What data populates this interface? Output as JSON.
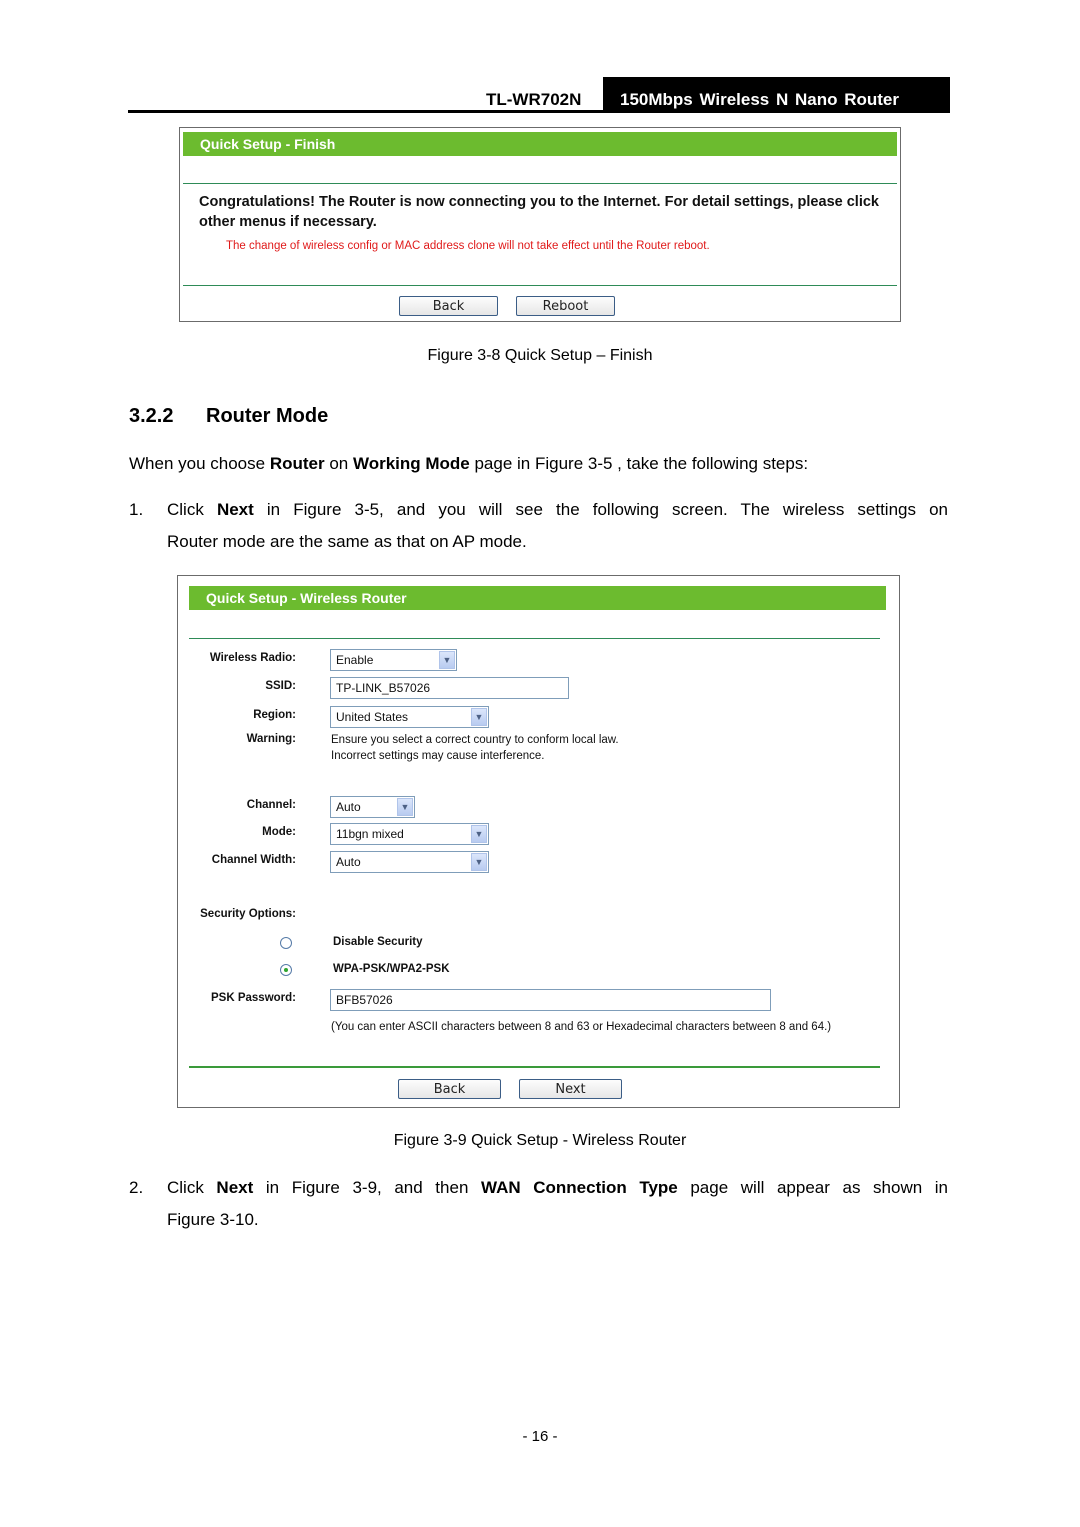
{
  "header": {
    "model": "TL-WR702N",
    "product": "150Mbps Wireless N Nano Router"
  },
  "figure_finish": {
    "title": "Quick Setup - Finish",
    "message": "Congratulations! The Router is now connecting you to the Internet. For detail settings, please click other menus if necessary.",
    "warning": "The change of wireless config or MAC address clone will not take effect until the Router reboot.",
    "buttons": {
      "back": "Back",
      "reboot": "Reboot"
    },
    "caption": "Figure 3-8 Quick Setup – Finish",
    "colors": {
      "title_bar": "#6cbb2f",
      "warning_text": "#e01a1a"
    }
  },
  "section": {
    "number": "3.2.2",
    "title": "Router Mode",
    "intro": {
      "t1": "When you choose ",
      "b1": "Router",
      "t2": " on ",
      "b2": "Working Mode",
      "t3": " page in Figure 3-5 , take the following steps:"
    },
    "step1": {
      "num": "1.",
      "t1": "Click ",
      "b1": "Next",
      "t2": " in Figure 3-5, and you will see the following screen. The wireless settings on",
      "line2": "Router mode are the same as that on AP mode."
    },
    "step2": {
      "num": "2.",
      "t1": "Click ",
      "b1": "Next",
      "t2": " in Figure 3-9, and then ",
      "b2": "WAN Connection Type",
      "t3": " page will appear as shown in",
      "line2": "Figure 3-10."
    }
  },
  "figure_wireless": {
    "title": "Quick Setup - Wireless Router",
    "fields": {
      "wireless_radio": {
        "label": "Wireless Radio:",
        "value": "Enable"
      },
      "ssid": {
        "label": "SSID:",
        "value": "TP-LINK_B57026"
      },
      "region": {
        "label": "Region:",
        "value": "United States"
      },
      "warning": {
        "label": "Warning:",
        "line1": "Ensure you select a correct country to conform local law.",
        "line2": "Incorrect settings may cause interference."
      },
      "channel": {
        "label": "Channel:",
        "value": "Auto"
      },
      "mode": {
        "label": "Mode:",
        "value": "11bgn mixed"
      },
      "channel_width": {
        "label": "Channel Width:",
        "value": "Auto"
      },
      "security_options": {
        "label": "Security Options:"
      },
      "security_choices": [
        {
          "label": "Disable Security",
          "selected": false
        },
        {
          "label": "WPA-PSK/WPA2-PSK",
          "selected": true
        }
      ],
      "psk_password": {
        "label": "PSK Password:",
        "value": "BFB57026",
        "hint": "(You can enter ASCII characters between 8 and 63 or Hexadecimal characters between 8 and 64.)"
      }
    },
    "buttons": {
      "back": "Back",
      "next": "Next"
    },
    "caption": "Figure 3-9 Quick Setup - Wireless Router",
    "icons": {
      "dropdown": "chevron-down-icon",
      "radio": "radio-button-icon"
    }
  },
  "footer": {
    "page_number": "- 16 -"
  }
}
